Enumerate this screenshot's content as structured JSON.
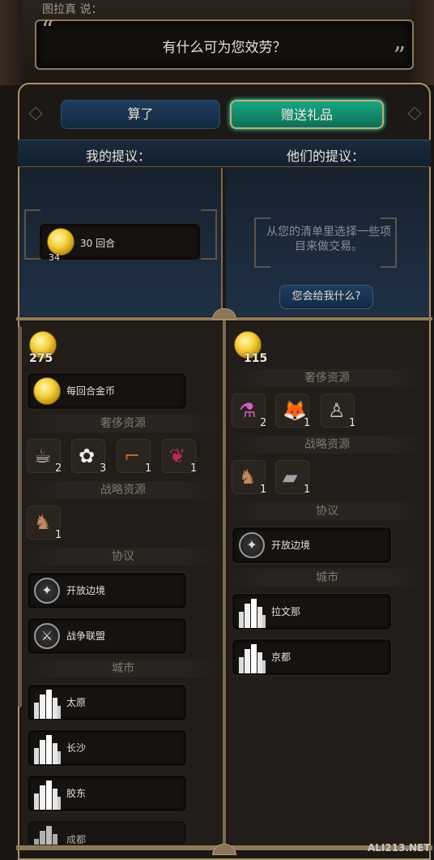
{
  "speaker": "图拉真 说：",
  "dialogue": "有什么可为您效劳？",
  "buttons": {
    "cancel": "算了",
    "gift": "赠送礼品"
  },
  "columns": {
    "mine": "我的提议：",
    "theirs": "他们的提议："
  },
  "my_offer": {
    "gold_per_turn_label": "30 回合",
    "gold_per_turn_count": "34"
  },
  "their_offer": {
    "hint": "从您的清单里选择一些项目来做交易。",
    "ask_button": "您会给我什么?"
  },
  "left": {
    "gold": "275",
    "gold_per_turn": "每回合金币",
    "luxury_header": "奢侈资源",
    "luxury": [
      {
        "icon": "coffee-icon",
        "count": "2"
      },
      {
        "icon": "cotton-icon",
        "count": "3"
      },
      {
        "icon": "pipe-icon",
        "count": "1"
      },
      {
        "icon": "wine-icon",
        "count": "1"
      }
    ],
    "strategic_header": "战略资源",
    "strategic": [
      {
        "icon": "horse-icon",
        "count": "1"
      }
    ],
    "agreements_header": "协议",
    "agreements": [
      "开放边境",
      "战争联盟"
    ],
    "cities_header": "城市",
    "cities": [
      "太原",
      "长沙",
      "胶东",
      "成都"
    ]
  },
  "right": {
    "gold": "115",
    "luxury_header": "奢侈资源",
    "luxury": [
      {
        "icon": "potion-icon",
        "count": "2"
      },
      {
        "icon": "fox-fur-icon",
        "count": "1"
      },
      {
        "icon": "statue-icon",
        "count": "1"
      }
    ],
    "strategic_header": "战略资源",
    "strategic": [
      {
        "icon": "horse-icon",
        "count": "1"
      },
      {
        "icon": "iron-anvil-icon",
        "count": "1"
      }
    ],
    "agreements_header": "协议",
    "agreements": [
      "开放边境"
    ],
    "cities_header": "城市",
    "cities": [
      "拉文那",
      "京都"
    ]
  },
  "watermark": "ALI213.NET"
}
